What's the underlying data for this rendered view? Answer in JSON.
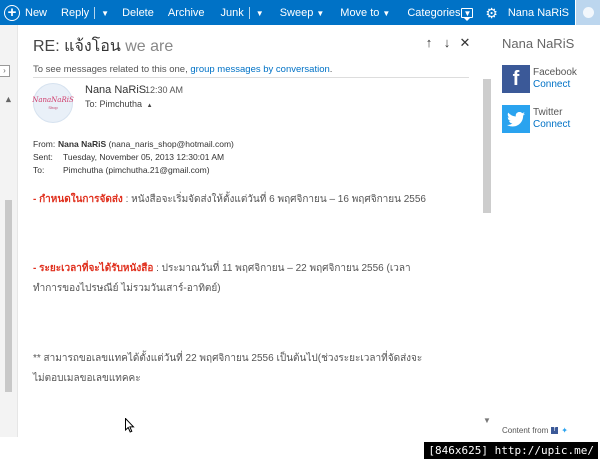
{
  "toolbar": {
    "new_label": "New",
    "reply_label": "Reply",
    "delete_label": "Delete",
    "archive_label": "Archive",
    "junk_label": "Junk",
    "sweep_label": "Sweep",
    "moveto_label": "Move to",
    "categories_label": "Categories",
    "user_name": "Nana NaRiS",
    "accent_color": "#0072c6"
  },
  "message": {
    "subject_prefix": "RE:",
    "subject_thai": "แจ้งโอน",
    "subject_rest": "we are",
    "related_text": "To see messages related to this one,",
    "related_link": "group messages by conversation",
    "related_end": ".",
    "avatar_logo": "NanaNaRiS",
    "avatar_sub": "Shop",
    "sender_name": "Nana NaRiS",
    "time": "12:30 AM",
    "to_label": "To:",
    "to_name": "Pimchutha",
    "header": {
      "from_label": "From:",
      "from_name": "Nana NaRiS",
      "from_email": "(nana_naris_shop@hotmail.com)",
      "sent_label": "Sent:",
      "sent_value": "Tuesday, November 05, 2013 12:30:01 AM",
      "to_label": "To:",
      "to_value": "Pimchutha (pimchutha.21@gmail.com)"
    },
    "paragraphs": [
      {
        "dash": "- ",
        "highlight": "กำหนดในการจัดส่ง",
        "text": " : หนังสือจะเริ่มจัดส่งให้ตั้งแต่วันที่ 6 พฤศจิกายน – 16 พฤศจิกายน 2556"
      },
      {
        "dash": "- ",
        "highlight": "ระยะเวลาที่จะได้รับหนังสือ",
        "text": " : ประมาณวันที่ 11 พฤศจิกายน – 22 พฤศจิกายน 2556 (เวลาทำการของไปรษณีย์ ไม่รวมวันเสาร์-อาทิตย์)"
      },
      {
        "dash": "",
        "highlight": "",
        "text": "** สามารถขอเลขแทคได้ตั้งแต่วันที่ 22 พฤศจิกายน 2556 เป็นต้นไป(ช่วงระยะเวลาที่จัดส่งจะไม่ตอบเมลขอเลขแทคคะ"
      }
    ],
    "highlight_color": "#e0301e"
  },
  "people_pane": {
    "contact_name": "Nana NaRiS",
    "facebook_title": "Facebook",
    "facebook_link": "Connect",
    "twitter_title": "Twitter",
    "twitter_link": "Connect",
    "content_from": "Content from",
    "facebook_color": "#3b5998",
    "twitter_color": "#2aa3ef"
  },
  "watermark": "[846x625] http://upic.me/"
}
